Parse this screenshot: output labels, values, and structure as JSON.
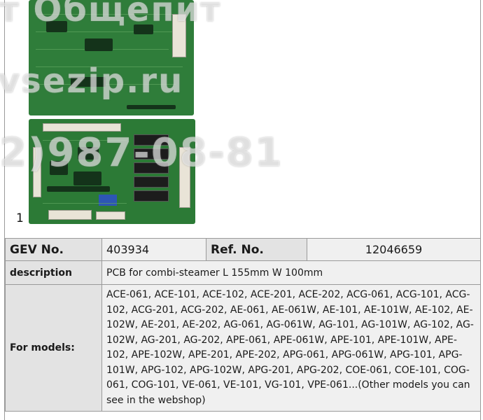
{
  "image": {
    "number": "1",
    "watermark_lines": [
      "т Общепит",
      "vsezip.ru",
      "2)987-08-81"
    ]
  },
  "spec": {
    "gev_label": "GEV No.",
    "gev_value": "403934",
    "ref_label": "Ref. No.",
    "ref_value": "12046659",
    "description_label": "description",
    "description_value": "PCB  for combi-steamer L 155mm W 100mm",
    "models_label": "For models:",
    "models_value": "ACE-061, ACE-101, ACE-102, ACE-201, ACE-202, ACG-061, ACG-101, ACG-102, ACG-201, ACG-202, AE-061, AE-061W, AE-101, AE-101W, AE-102, AE-102W, AE-201, AE-202, AG-061, AG-061W, AG-101, AG-101W, AG-102, AG-102W, AG-201, AG-202, APE-061, APE-061W, APE-101, APE-101W, APE-102, APE-102W, APE-201, APE-202, APG-061, APG-061W, APG-101, APG-101W, APG-102, APG-102W, APG-201, APG-202, COE-061, COE-101, COG-061, COG-101, VE-061, VE-101, VG-101, VPE-061...(Other models you can see in the webshop)"
  },
  "colors": {
    "pcb_green": "#2f7d3a",
    "header_bg": "#e3e3e3",
    "value_bg": "#f0f0f0",
    "border": "#9a9a9a"
  }
}
